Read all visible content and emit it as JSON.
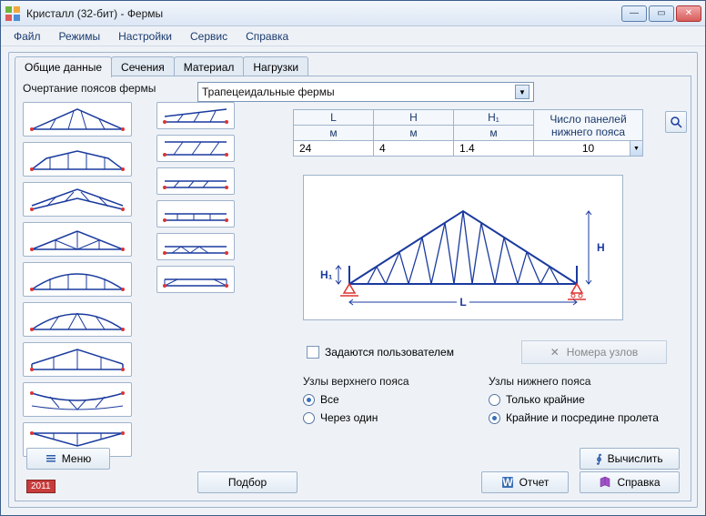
{
  "window": {
    "title": "Кристалл (32-бит) - Фермы"
  },
  "menu": {
    "file": "Файл",
    "modes": "Режимы",
    "settings": "Настройки",
    "service": "Сервис",
    "help": "Справка"
  },
  "tabs": {
    "general": "Общие данные",
    "sections": "Сечения",
    "material": "Материал",
    "loads": "Нагрузки"
  },
  "outline_label": "Очертание поясов фермы",
  "truss_type": {
    "selected": "Трапецеидальные фермы"
  },
  "params": {
    "L": {
      "label": "L",
      "unit": "м",
      "value": "24"
    },
    "H": {
      "label": "H",
      "unit": "м",
      "value": "4"
    },
    "H1": {
      "label": "H₁",
      "unit": "м",
      "value": "1.4"
    },
    "panels": {
      "label": "Число панелей нижнего пояса",
      "value": "10"
    }
  },
  "diagram": {
    "L": "L",
    "H": "H",
    "H1": "H₁"
  },
  "user_nodes": {
    "label": "Задаются пользователем",
    "checked": false
  },
  "nodes_btn": "Номера узлов",
  "top_chord": {
    "title": "Узлы верхнего пояса",
    "all": "Все",
    "every_other": "Через один",
    "selected": "all"
  },
  "bottom_chord": {
    "title": "Узлы нижнего пояса",
    "ends": "Только крайние",
    "ends_mid": "Крайние и посредине пролета",
    "selected": "ends_mid"
  },
  "buttons": {
    "menu": "Меню",
    "podbor": "Подбор",
    "compute": "Вычислить",
    "report": "Отчет",
    "help": "Справка"
  },
  "year": "2011"
}
